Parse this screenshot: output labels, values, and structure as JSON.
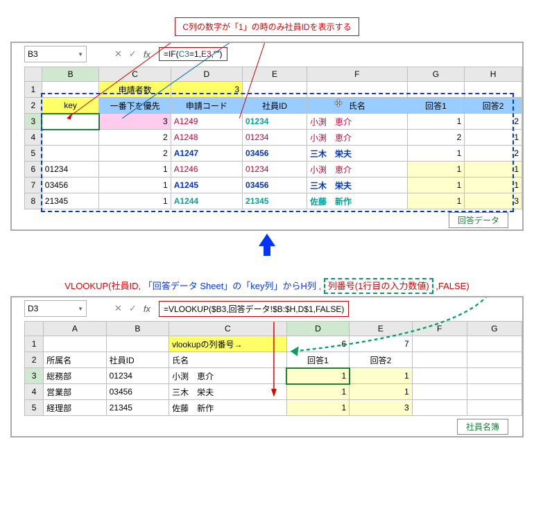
{
  "annotations": {
    "top": "C列の数字が「1」の時のみ社員IDを表示する",
    "vlookup_prefix": "VLOOKUP(社員ID, ",
    "vlookup_blue": "「回答データ Sheet」の「key列」からH列",
    "vlookup_mid2": " , ",
    "vlookup_green": "列番号(1行目の入力数値)",
    "vlookup_suffix": " ,FALSE)"
  },
  "panel1": {
    "namebox": "B3",
    "fx": "fx",
    "formula_parts": {
      "p0": "=IF(",
      "p1": "C3",
      "p2": "=1,",
      "p3": "E3",
      "p4": ",\"\")"
    },
    "cols": [
      "",
      "B",
      "C",
      "D",
      "E",
      "F",
      "G",
      "H"
    ],
    "row1": {
      "r": "1",
      "c": "申請者数",
      "d": "3"
    },
    "hdr": {
      "b": "key",
      "c": "一番下を優先",
      "d": "申請コード",
      "e": "社員ID",
      "f": "氏名",
      "g": "回答1",
      "h": "回答2"
    },
    "rows": [
      {
        "r": "3",
        "b": "",
        "c": "3",
        "d": "A1249",
        "e": "01234",
        "f": "小渕　恵介",
        "g": "1",
        "h": "2",
        "cls": "pink",
        "code": "red",
        "id": "teal"
      },
      {
        "r": "4",
        "b": "",
        "c": "2",
        "d": "A1248",
        "e": "01234",
        "f": "小渕　恵介",
        "g": "2",
        "h": "1",
        "cls": "",
        "code": "red",
        "id": "red"
      },
      {
        "r": "5",
        "b": "",
        "c": "2",
        "d": "A1247",
        "e": "03456",
        "f": "三木　栄夫",
        "g": "1",
        "h": "2",
        "cls": "",
        "code": "blue",
        "id": "blue"
      },
      {
        "r": "6",
        "b": "01234",
        "c": "1",
        "d": "A1246",
        "e": "01234",
        "f": "小渕　恵介",
        "g": "1",
        "h": "1",
        "cls": "",
        "code": "red",
        "id": "red",
        "hl": true
      },
      {
        "r": "7",
        "b": "03456",
        "c": "1",
        "d": "A1245",
        "e": "03456",
        "f": "三木　栄夫",
        "g": "1",
        "h": "1",
        "cls": "",
        "code": "blue",
        "id": "blue",
        "hl": true
      },
      {
        "r": "8",
        "b": "21345",
        "c": "1",
        "d": "A1244",
        "e": "21345",
        "f": "佐藤　新作",
        "g": "1",
        "h": "3",
        "cls": "",
        "code": "teal",
        "id": "teal",
        "hl": true
      }
    ],
    "tab": "回答データ"
  },
  "panel2": {
    "namebox": "D3",
    "fx": "fx",
    "formula": "=VLOOKUP($B3,回答データ!$B:$H,D$1,FALSE)",
    "cols": [
      "",
      "A",
      "B",
      "C",
      "D",
      "E",
      "F",
      "G"
    ],
    "row1": {
      "r": "1",
      "clabel": "vlookupの列番号→",
      "d": "6",
      "e": "7"
    },
    "hdr": {
      "a": "所属名",
      "b": "社員ID",
      "c": "氏名",
      "d": "回答1",
      "e": "回答2"
    },
    "rows": [
      {
        "r": "3",
        "a": "総務部",
        "b": "01234",
        "c": "小渕　恵介",
        "d": "1",
        "e": "1",
        "sel": true
      },
      {
        "r": "4",
        "a": "営業部",
        "b": "03456",
        "c": "三木　栄夫",
        "d": "1",
        "e": "1"
      },
      {
        "r": "5",
        "a": "経理部",
        "b": "21345",
        "c": "佐藤　新作",
        "d": "1",
        "e": "3"
      }
    ],
    "tab": "社員名簿"
  }
}
